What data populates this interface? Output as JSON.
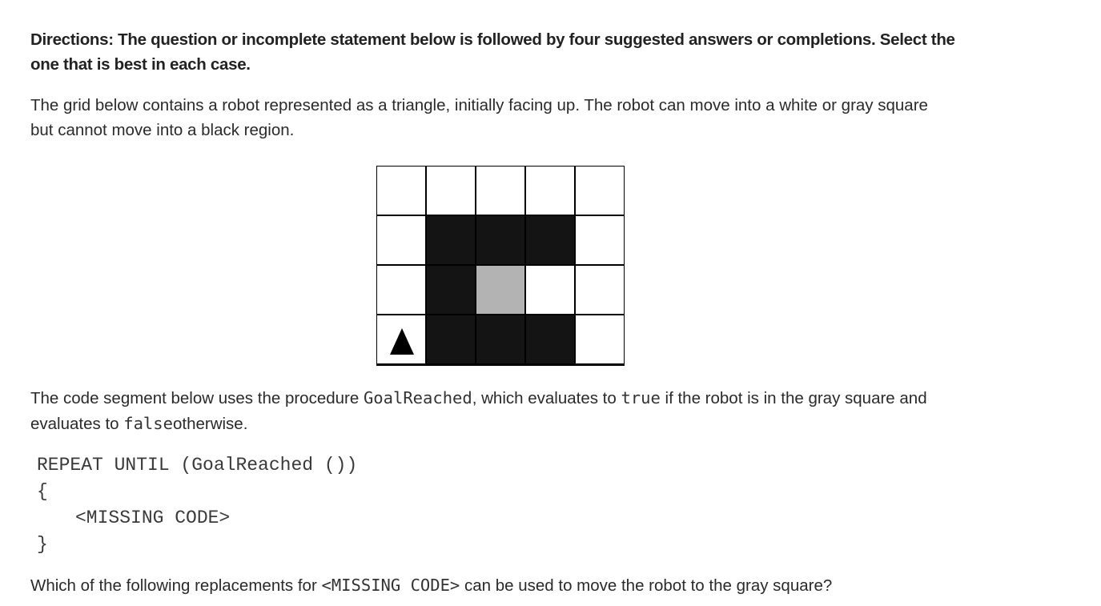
{
  "directions": "Directions: The question or incomplete statement below is followed by four suggested answers or completions. Select the one that is best in each case.",
  "intro": "The grid below contains a robot represented as a triangle, initially facing up. The robot can move into a white or gray square but cannot move into a black region.",
  "grid": {
    "rows": [
      [
        "white",
        "white",
        "white",
        "white",
        "white"
      ],
      [
        "white",
        "black",
        "black",
        "black",
        "white"
      ],
      [
        "white",
        "black",
        "gray",
        "white",
        "white"
      ],
      [
        "robot",
        "black",
        "black",
        "black",
        "white"
      ]
    ],
    "robot_facing": "up"
  },
  "segment": {
    "part1": "The code segment below uses the procedure ",
    "proc": "GoalReached",
    "part2": ", which evaluates to ",
    "true_kw": "true",
    "part3": " if the robot is in the gray square and evaluates to ",
    "false_kw": "false",
    "part4": "otherwise."
  },
  "code": {
    "line1": "REPEAT UNTIL (GoalReached ())",
    "line2": "{",
    "line3": "<MISSING CODE>",
    "line4": "}"
  },
  "question": {
    "part1": "Which of the following replacements for ",
    "missing": "<MISSING CODE>",
    "part2": " can be used to move the robot to the gray square?"
  }
}
